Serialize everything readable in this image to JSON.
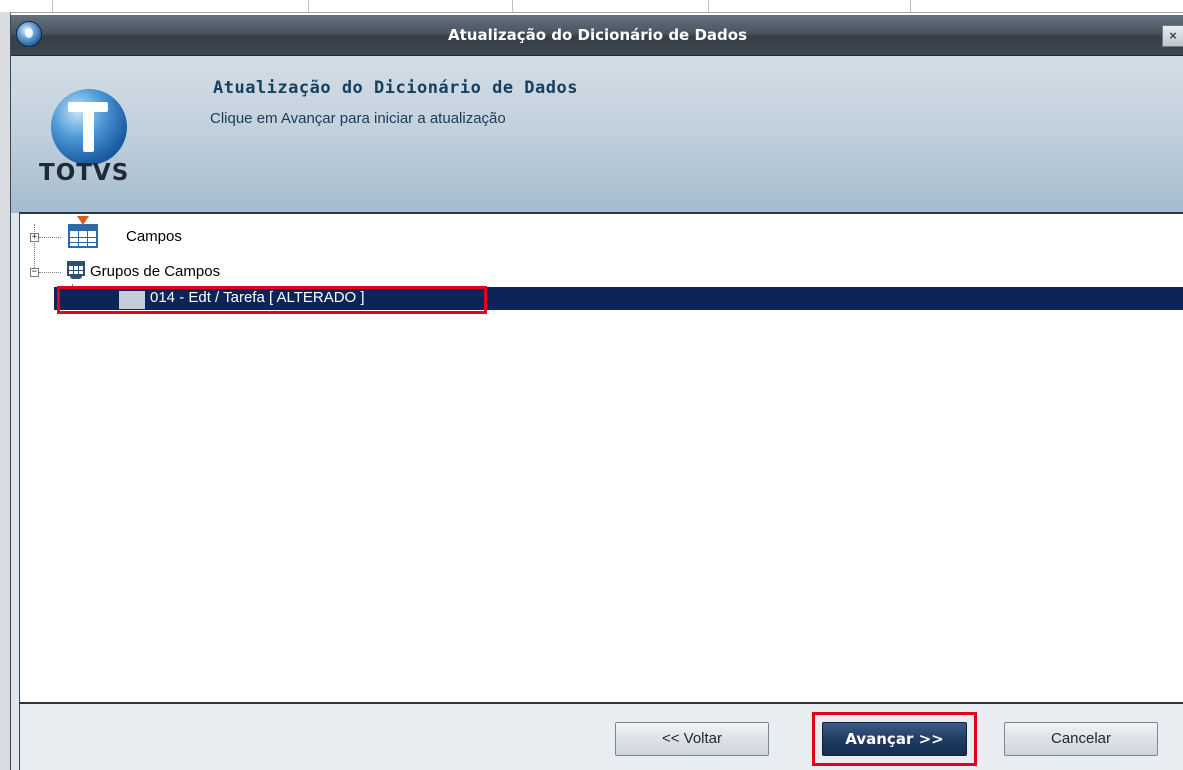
{
  "window": {
    "title": "Atualização do Dicionário de Dados",
    "close_label": "×"
  },
  "header": {
    "title": "Atualização do Dicionário de Dados",
    "subtitle": "Clique em Avançar para iniciar a atualização",
    "logo_text": "TOTVS"
  },
  "tree": {
    "items": [
      {
        "label": "Campos",
        "expander": "+"
      },
      {
        "label": "Grupos de Campos",
        "expander": "−"
      }
    ],
    "selected_item": {
      "label": "014 - Edt / Tarefa  [ ALTERADO ]"
    }
  },
  "buttons": {
    "back": "<< Voltar",
    "next": "Avançar >>",
    "cancel": "Cancelar"
  },
  "colors": {
    "highlight": "#e2001a",
    "selection": "#0e2458",
    "title_bar": "#4a5560"
  }
}
